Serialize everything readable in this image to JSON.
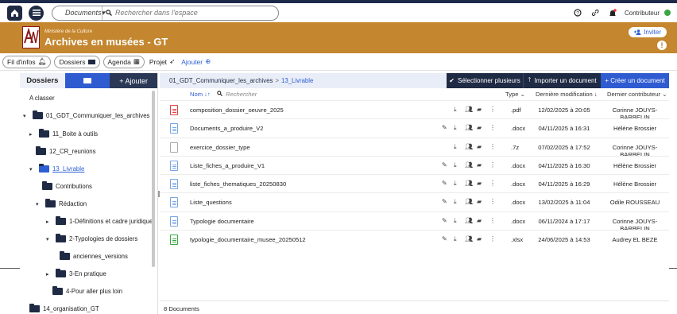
{
  "topbar": {
    "scope": "Documents",
    "search_placeholder": "Rechercher dans l'espace",
    "user_role": "Contributeur"
  },
  "banner": {
    "subtitle": "Ministère de la Culture",
    "title": "Archives en musées - GT",
    "invite_label": "Inviter",
    "info_label": "!"
  },
  "nav": {
    "items": [
      "Fil d'infos",
      "Dossiers",
      "Agenda",
      "Projet",
      "Ajouter"
    ]
  },
  "sidebar": {
    "title": "Dossiers",
    "add_label": "+ Ajouter",
    "tree": [
      {
        "label": "A classer"
      },
      {
        "label": "01_GDT_Communiquer_les_archives"
      },
      {
        "label": "11_Boite à outils"
      },
      {
        "label": "12_CR_reunions"
      },
      {
        "label": "13_Livrable"
      },
      {
        "label": "Contributions"
      },
      {
        "label": "Rédaction"
      },
      {
        "label": "1-Définitions et cadre juridique"
      },
      {
        "label": "2-Typologies de dossiers"
      },
      {
        "label": "anciennes_versions"
      },
      {
        "label": "3-En pratique"
      },
      {
        "label": "4-Pour aller plus loin"
      },
      {
        "label": "14_organisation_GT"
      }
    ]
  },
  "main": {
    "breadcrumb": {
      "parent": "01_GDT_Communiquer_les_archives",
      "separator": ">",
      "current": "13_Livrable"
    },
    "actions": {
      "select_multiple": "Sélectionner plusieurs",
      "import": "Importer un document",
      "create": "+ Créer un document"
    },
    "columns": {
      "name": "Nom",
      "search": "Rechercher",
      "type": "Type",
      "modified": "Dernière modification",
      "contributor": "Dernier contributeur"
    },
    "documents": [
      {
        "name": "composition_dossier_oeuvre_2025",
        "type": ".pdf",
        "date": "12/02/2025 à 20:05",
        "user": "Corinne JOUYS-BARBELIN",
        "icon": "pdf-file-icon",
        "editable": false
      },
      {
        "name": "Documents_a_produire_V2",
        "type": ".docx",
        "date": "04/11/2025 à 16:31",
        "user": "Hélène Brossier",
        "icon": "doc-file-icon",
        "editable": true
      },
      {
        "name": "exercice_dossier_type",
        "type": ".7z",
        "date": "07/02/2025 à 17:52",
        "user": "Corinne JOUYS-BARBELIN",
        "icon": "generic-file-icon",
        "editable": false
      },
      {
        "name": "Liste_fiches_a_produire_V1",
        "type": ".docx",
        "date": "04/11/2025 à 16:30",
        "user": "Hélène Brossier",
        "icon": "doc-file-icon",
        "editable": true
      },
      {
        "name": "liste_fiches_thematiques_20250830",
        "type": ".docx",
        "date": "04/11/2025 à 16:29",
        "user": "Hélène Brossier",
        "icon": "doc-file-icon",
        "editable": true
      },
      {
        "name": "Liste_questions",
        "type": ".docx",
        "date": "13/02/2025 à 11:04",
        "user": "Odile ROUSSEAU",
        "icon": "doc-file-icon",
        "editable": true
      },
      {
        "name": "Typologie documentaire",
        "type": ".docx",
        "date": "06/11/2024 à 17:17",
        "user": "Corinne JOUYS-BARBELIN",
        "icon": "doc-file-icon",
        "editable": true
      },
      {
        "name": "typologie_documentaire_musee_20250512",
        "type": ".xlsx",
        "date": "24/06/2025 à 14:53",
        "user": "Audrey EL BEZE",
        "icon": "xlsx-file-icon",
        "editable": true
      }
    ],
    "footer": "8 Documents"
  },
  "colors": {
    "navy": "#1f2a44",
    "blue": "#2f5bd1",
    "banner": "#c4862f"
  }
}
